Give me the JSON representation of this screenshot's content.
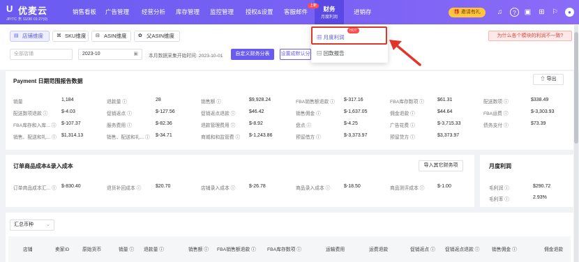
{
  "app": {
    "brand": "优麦云",
    "region": "JP/TC 东 11/30 01:27(0)",
    "brand_color": "#6a5bf0"
  },
  "nav": [
    {
      "label": "销售看板",
      "x": 0
    },
    {
      "label": "广告管理"
    },
    {
      "label": "经营分析"
    },
    {
      "label": "库存管理"
    },
    {
      "label": "监控管理"
    },
    {
      "label": "授权&设置"
    },
    {
      "label": "客服邮件"
    },
    {
      "label": "财务",
      "sub": "月度利润",
      "badge": "上新"
    },
    {
      "label": "进销存"
    }
  ],
  "topright": {
    "invite": "邀请有礼"
  },
  "tabs": [
    {
      "label": "店铺维度",
      "icon": "shop"
    },
    {
      "label": "SKU维度",
      "icon": "sku"
    },
    {
      "label": "ASIN维度",
      "icon": "asin"
    },
    {
      "label": "父ASIN维度",
      "icon": "parent"
    }
  ],
  "banner": "为什么各个模块的利润不一致?",
  "filters": {
    "shop_placeholder": "全部店铺",
    "month": "2023-10",
    "collect_note": "本月数据采集开始时间: 2023-10-01",
    "custom_btn": "自定义财务分表",
    "setting_btn": "设置成默认分表"
  },
  "dropdown": {
    "item1": "月度利润",
    "item1_badge": "HOT",
    "item2": "回款报告"
  },
  "payment": {
    "title": "Payment 日期范围报告数据",
    "export": "导出",
    "metrics": [
      [
        "销量",
        "1,184"
      ],
      [
        "退款量 ⓘ",
        "28"
      ],
      [
        "销售额 ⓘ",
        "$9,928.24"
      ],
      [
        "FBA销售额退款 ⓘ",
        "$-317.16"
      ],
      [
        "FBA库存数项 ⓘ",
        "$61.31"
      ],
      [
        "配送数项 ⓘ",
        "$338.49"
      ],
      [
        "配送数项退款 ⓘ",
        "$-4.03"
      ],
      [
        "促销返点 ⓘ",
        "$-127.56"
      ],
      [
        "促销返点退款 ⓘ",
        "$46.42"
      ],
      [
        "销售佣金 ⓘ",
        "$-1,637.05"
      ],
      [
        "佣金退款 ⓘ",
        "$44.64"
      ],
      [
        "FBA运费 ⓘ",
        "$-3,303.93"
      ],
      [
        "FBA库存和入库... ⓘ",
        "$-107.37"
      ],
      [
        "服务费用 ⓘ",
        "$-82.36"
      ],
      [
        "退款管理费用 ⓘ",
        "$-8.92"
      ],
      [
        "盘点 ⓘ",
        "$-4.25"
      ],
      [
        "广告花费 ⓘ",
        "$-3,715.33"
      ],
      [
        "债务支付 ⓘ",
        "$73.39"
      ],
      [
        "销售、配送和礼... ⓘ",
        "$1,314.13"
      ],
      [
        "销售、配送和礼... ⓘ",
        "$-34.71"
      ],
      [
        "商城和和监管费 ⓘ",
        "$-1,243.86"
      ],
      [
        "预留借方 ⓘ",
        "$-3,373.97"
      ],
      [
        "预留贷方 ⓘ",
        "$3,373.97"
      ]
    ]
  },
  "cost": {
    "title": "订单商品成本&录入成本",
    "import_btn": "导入其它财务项",
    "metrics": [
      [
        "订单商品成本汇... ⓘ",
        "$-830.40"
      ],
      [
        "退货补回成本 ⓘ",
        "$20.70"
      ],
      [
        "店铺录入成本 ⓘ",
        "$-26.78"
      ],
      [
        "商品录入成本 ⓘ",
        "$-18.50"
      ],
      [
        "商品测评成本 ⓘ",
        "$-1.00"
      ]
    ]
  },
  "profit": {
    "title": "月度利润",
    "rows": [
      [
        "毛利润 ⓘ",
        "$290.72"
      ],
      [
        "毛利率 ⓘ",
        "2.93%"
      ]
    ]
  },
  "currency": "汇总币种",
  "table_headers": [
    "店铺",
    "卖家ID",
    "原始货币",
    "销量 ⓘ",
    "退款量 ⓘ",
    "销售额 ⓘ",
    "FBA销售额退款 ⓘ",
    "FBA库存数项 ⓘ",
    "运输费用",
    "运费退款",
    "促销返点 ⓘ",
    "促销返点退款 ⓘ",
    "销售佣金 ⓘ",
    "佣金退款"
  ]
}
